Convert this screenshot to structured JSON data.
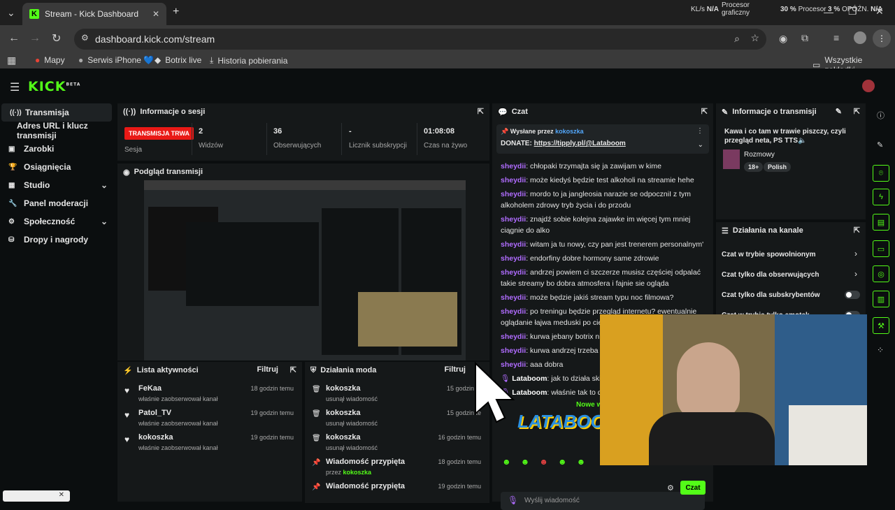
{
  "browser": {
    "tab_title": "Stream - Kick Dashboard",
    "url": "dashboard.kick.com/stream",
    "bookmarks": [
      "Mapy",
      "Serwis iPhone 💙",
      "Botrix live",
      "Historia pobierania"
    ],
    "all_bookmarks": "Wszystkie zakładki",
    "sys": {
      "kl_label": "KL/s",
      "kl_val": "N/A",
      "gpu_top": "Procesor",
      "gpu_bot": "graficzny",
      "cpu_val": "30 %",
      "cpu_label": "Procesor",
      "lat_val": "3 %",
      "lat_label": "OPÓŹN.",
      "lat_na": "N/A"
    }
  },
  "nav": {
    "logo": "KICK",
    "beta": "BETA"
  },
  "sidebar": [
    {
      "label": "Transmisja",
      "icon": "signal-icon",
      "active": true
    },
    {
      "label": "Adres URL i klucz transmisji",
      "icon": "",
      "active": false
    },
    {
      "label": "Zarobki",
      "icon": "wallet-icon"
    },
    {
      "label": "Osiągnięcia",
      "icon": "trophy-icon"
    },
    {
      "label": "Studio",
      "icon": "studio-icon",
      "chevron": true
    },
    {
      "label": "Panel moderacji",
      "icon": "wrench-icon"
    },
    {
      "label": "Społeczność",
      "icon": "community-icon",
      "chevron": true
    },
    {
      "label": "Dropy i nagrody",
      "icon": "gift-icon"
    }
  ],
  "session": {
    "title": "Informacje o sesji",
    "badge": "TRANSMISJA TRWA",
    "badge_label": "Sesja",
    "stats": [
      {
        "v": "2",
        "l": "Widzów"
      },
      {
        "v": "36",
        "l": "Obserwujących"
      },
      {
        "v": "-",
        "l": "Licznik subskrypcji"
      },
      {
        "v": "01:08:08",
        "l": "Czas na żywo"
      }
    ]
  },
  "preview": {
    "title": "Podgląd transmisji"
  },
  "activity": {
    "title": "Lista aktywności",
    "filter": "Filtruj",
    "items": [
      {
        "name": "FeKaa",
        "desc": "właśnie zaobserwował kanał",
        "time": "18 godzin temu"
      },
      {
        "name": "Patol_TV",
        "desc": "właśnie zaobserwował kanał",
        "time": "19 godzin temu"
      },
      {
        "name": "kokoszka",
        "desc": "właśnie zaobserwował kanał",
        "time": "19 godzin temu"
      }
    ]
  },
  "modactions": {
    "title": "Działania moda",
    "filter": "Filtruj",
    "items": [
      {
        "name": "kokoszka",
        "desc": "usunął wiadomość",
        "time": "15 godzin te"
      },
      {
        "name": "kokoszka",
        "desc": "usunął wiadomość",
        "time": "15 godzin te"
      },
      {
        "name": "kokoszka",
        "desc": "usunął wiadomość",
        "time": "16 godzin temu"
      },
      {
        "name": "Wiadomość przypięta",
        "desc": "przez",
        "by": "kokoszka",
        "time": "18 godzin temu"
      },
      {
        "name": "Wiadomość przypięta",
        "desc": "",
        "time": "19 godzin temu"
      }
    ]
  },
  "chat": {
    "title": "Czat",
    "pinned_by": "Wysłane przez",
    "pinned_user": "kokoszka",
    "pinned_msg": "DONATE: ",
    "pinned_link": "https://tipply.pl/@Lataboom",
    "messages": [
      {
        "u": "sheydii",
        "m": "chłopaki trzymajta się ja zawijam w kime"
      },
      {
        "u": "sheydii",
        "m": "może kiedyś będzie test alkoholi na streamie hehe"
      },
      {
        "u": "sheydii",
        "m": "mordo to ja jangleosia narazie se odpoczniI z tym alkoholem zdrowy tryb życia i do przodu"
      },
      {
        "u": "sheydii",
        "m": "znajdź sobie kolejna zajawke im więcej tym mniej ciągnie do alko"
      },
      {
        "u": "sheydii",
        "m": "witam ja tu nowy, czy pan jest trenerem personalnym'"
      },
      {
        "u": "sheydii",
        "m": "endorfiny dobre hormony same zdrowie"
      },
      {
        "u": "sheydii",
        "m": "andrzej powiem ci szczerze musisz częściej odpalać takie streamy bo dobra atmosfera i fajnie sie ogląda"
      },
      {
        "u": "sheydii",
        "m": "może będzie jakiś stream typu noc filmowa?"
      },
      {
        "u": "sheydii",
        "m": "po treningu będzie przegląd internetu? ewentualnie oglądanie łajwa meduski po ciemku?"
      },
      {
        "u": "sheydii",
        "m": "kurwa jebany botrix nic nie"
      },
      {
        "u": "sheydii",
        "m": "kurwa andrzej trzeba się w używać"
      },
      {
        "u": "sheydii",
        "m": "aaa dobra"
      },
      {
        "u": "Lataboom",
        "m": "jak to działa skirlitirli"
      },
      {
        "u": "Lataboom",
        "m": "właśnie tak to działa"
      }
    ],
    "new_msg": "Nowe w",
    "input_placeholder": "Wyślij wiadomość",
    "send": "Czat"
  },
  "stream_info": {
    "title": "Informacje o transmisji",
    "stream_title": "Kawa i co tam w trawie piszczy, czyli przegląd neta, PS TTS🔈",
    "category": "Rozmowy",
    "tags": [
      "18+",
      "Polish"
    ]
  },
  "channel_actions": {
    "title": "Działania na kanale",
    "items": [
      {
        "label": "Czat w trybie spowolnionym",
        "type": "chevron"
      },
      {
        "label": "Czat tylko dla obserwujących",
        "type": "chevron"
      },
      {
        "label": "Czat tylko dla subskrybentów",
        "type": "toggle"
      },
      {
        "label": "Czat w trybie tylko emotek",
        "type": "toggle"
      }
    ]
  },
  "overlay_logo": "LATABOOM"
}
